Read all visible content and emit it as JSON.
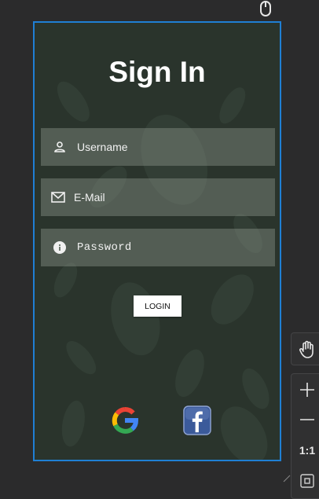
{
  "screen": {
    "title": "Sign In",
    "fields": [
      {
        "icon": "person-icon",
        "value": "Username"
      },
      {
        "icon": "mail-icon",
        "value": "E-Mail"
      },
      {
        "icon": "info-icon",
        "value": "Password"
      }
    ],
    "login_label": "LOGIN",
    "social": [
      "google-icon",
      "facebook-icon"
    ]
  },
  "toolbar": {
    "zoom_reset_label": "1:1"
  },
  "colors": {
    "frame_border": "#1f7fd4",
    "background": "#2a342c",
    "field_fill": "#7b857c"
  }
}
